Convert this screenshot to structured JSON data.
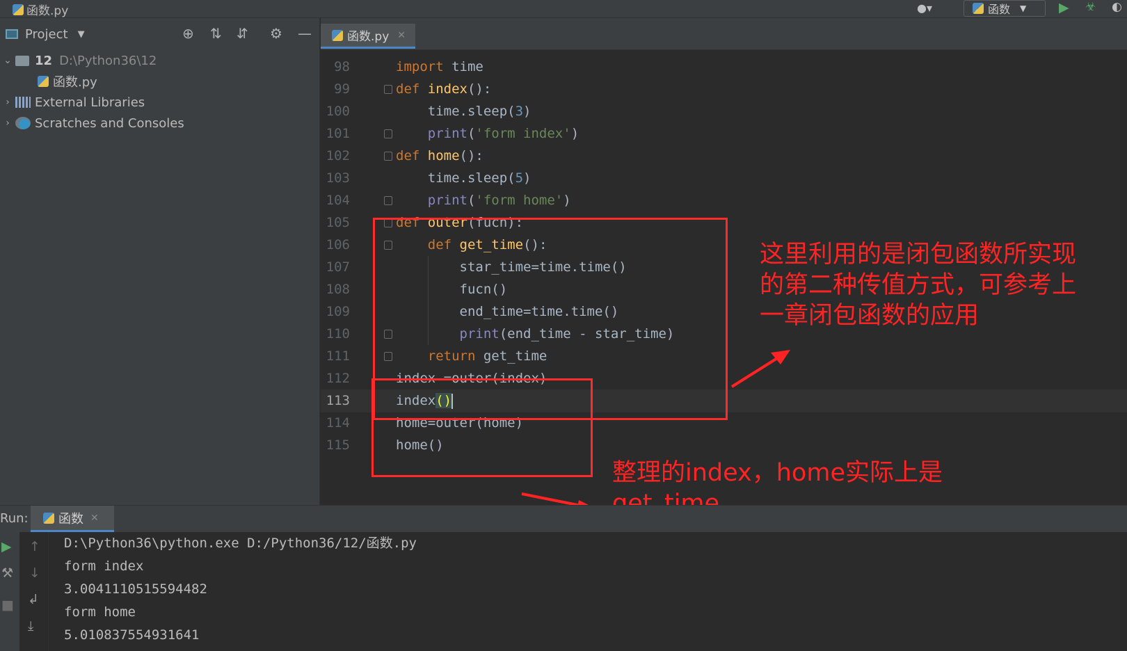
{
  "titlebar": {
    "file": "函数.py",
    "run_config": "函数",
    "user_icon": "user-icon",
    "run_icon": "run-icon",
    "debug_icon": "debug-icon",
    "coverage_icon": "coverage-icon"
  },
  "project": {
    "header": "Project",
    "tree": [
      {
        "name": "12",
        "path": "D:\\Python36\\12",
        "type": "folder",
        "expanded": true
      },
      {
        "name": "函数.py",
        "type": "python-file"
      },
      {
        "name": "External Libraries",
        "type": "library"
      },
      {
        "name": "Scratches and Consoles",
        "type": "scratches"
      }
    ]
  },
  "editor": {
    "tab": "函数.py",
    "current_line": 113,
    "lines": [
      {
        "no": "98",
        "code": "import time"
      },
      {
        "no": "99",
        "code": "def index():"
      },
      {
        "no": "100",
        "code": "    time.sleep(3)"
      },
      {
        "no": "101",
        "code": "    print('form index')"
      },
      {
        "no": "102",
        "code": "def home():"
      },
      {
        "no": "103",
        "code": "    time.sleep(5)"
      },
      {
        "no": "104",
        "code": "    print('form home')"
      },
      {
        "no": "105",
        "code": "def outer(fucn):"
      },
      {
        "no": "106",
        "code": "    def get_time():"
      },
      {
        "no": "107",
        "code": "        star_time=time.time()"
      },
      {
        "no": "108",
        "code": "        fucn()"
      },
      {
        "no": "109",
        "code": "        end_time=time.time()"
      },
      {
        "no": "110",
        "code": "        print(end_time - star_time)"
      },
      {
        "no": "111",
        "code": "    return get_time"
      },
      {
        "no": "112",
        "code": "index =outer(index)"
      },
      {
        "no": "113",
        "code": "index()"
      },
      {
        "no": "114",
        "code": "home=outer(home)"
      },
      {
        "no": "115",
        "code": "home()"
      }
    ]
  },
  "annotations": {
    "note1": [
      "这里利用的是闭包函数所实现",
      "的第二种传值方式，可参考上",
      "一章闭包函数的应用"
    ],
    "note2": [
      "整理的index，home实际上是",
      "get_time"
    ],
    "color": "#ff2323"
  },
  "run": {
    "label": "Run:",
    "tab": "函数",
    "output": [
      "D:\\Python36\\python.exe D:/Python36/12/函数.py",
      "form index",
      "3.0041110515594482",
      "form home",
      "5.010837554931641"
    ]
  },
  "colors": {
    "keyword": "#cc7832",
    "function": "#ffc66d",
    "string": "#6a8759",
    "number": "#6897bb",
    "builtin": "#8888c6",
    "background": "#2b2b2b",
    "panel": "#3c3f41"
  }
}
